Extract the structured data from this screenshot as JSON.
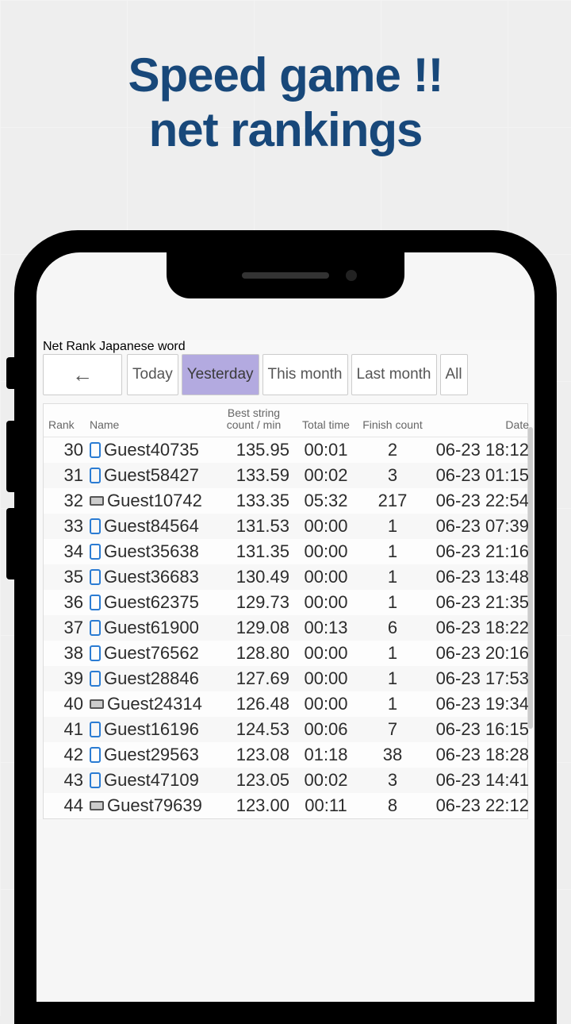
{
  "headline": {
    "line1": "Speed game !!",
    "line2": "net rankings"
  },
  "app": {
    "title": "Net Rank Japanese word",
    "back": "←",
    "tabs": [
      {
        "label": "Today",
        "selected": false
      },
      {
        "label": "Yesterday",
        "selected": true
      },
      {
        "label": "This month",
        "selected": false
      },
      {
        "label": "Last month",
        "selected": false
      },
      {
        "label": "All",
        "selected": false
      }
    ],
    "headers": {
      "rank": "Rank",
      "name": "Name",
      "score": "Best string count / min",
      "time": "Total time",
      "count": "Finish count",
      "date": "Date"
    },
    "rows": [
      {
        "rank": 30,
        "device": "mobile",
        "name": "Guest40735",
        "score": "135.95",
        "time": "00:01",
        "count": 2,
        "date": "06-23 18:12"
      },
      {
        "rank": 31,
        "device": "mobile",
        "name": "Guest58427",
        "score": "133.59",
        "time": "00:02",
        "count": 3,
        "date": "06-23 01:15"
      },
      {
        "rank": 32,
        "device": "desktop",
        "name": "Guest10742",
        "score": "133.35",
        "time": "05:32",
        "count": 217,
        "date": "06-23 22:54"
      },
      {
        "rank": 33,
        "device": "mobile",
        "name": "Guest84564",
        "score": "131.53",
        "time": "00:00",
        "count": 1,
        "date": "06-23 07:39"
      },
      {
        "rank": 34,
        "device": "mobile",
        "name": "Guest35638",
        "score": "131.35",
        "time": "00:00",
        "count": 1,
        "date": "06-23 21:16"
      },
      {
        "rank": 35,
        "device": "mobile",
        "name": "Guest36683",
        "score": "130.49",
        "time": "00:00",
        "count": 1,
        "date": "06-23 13:48"
      },
      {
        "rank": 36,
        "device": "mobile",
        "name": "Guest62375",
        "score": "129.73",
        "time": "00:00",
        "count": 1,
        "date": "06-23 21:35"
      },
      {
        "rank": 37,
        "device": "mobile",
        "name": "Guest61900",
        "score": "129.08",
        "time": "00:13",
        "count": 6,
        "date": "06-23 18:22"
      },
      {
        "rank": 38,
        "device": "mobile",
        "name": "Guest76562",
        "score": "128.80",
        "time": "00:00",
        "count": 1,
        "date": "06-23 20:16"
      },
      {
        "rank": 39,
        "device": "mobile",
        "name": "Guest28846",
        "score": "127.69",
        "time": "00:00",
        "count": 1,
        "date": "06-23 17:53"
      },
      {
        "rank": 40,
        "device": "desktop",
        "name": "Guest24314",
        "score": "126.48",
        "time": "00:00",
        "count": 1,
        "date": "06-23 19:34"
      },
      {
        "rank": 41,
        "device": "mobile",
        "name": "Guest16196",
        "score": "124.53",
        "time": "00:06",
        "count": 7,
        "date": "06-23 16:15"
      },
      {
        "rank": 42,
        "device": "mobile",
        "name": "Guest29563",
        "score": "123.08",
        "time": "01:18",
        "count": 38,
        "date": "06-23 18:28"
      },
      {
        "rank": 43,
        "device": "mobile",
        "name": "Guest47109",
        "score": "123.05",
        "time": "00:02",
        "count": 3,
        "date": "06-23 14:41"
      },
      {
        "rank": 44,
        "device": "desktop",
        "name": "Guest79639",
        "score": "123.00",
        "time": "00:11",
        "count": 8,
        "date": "06-23 22:12"
      }
    ]
  }
}
